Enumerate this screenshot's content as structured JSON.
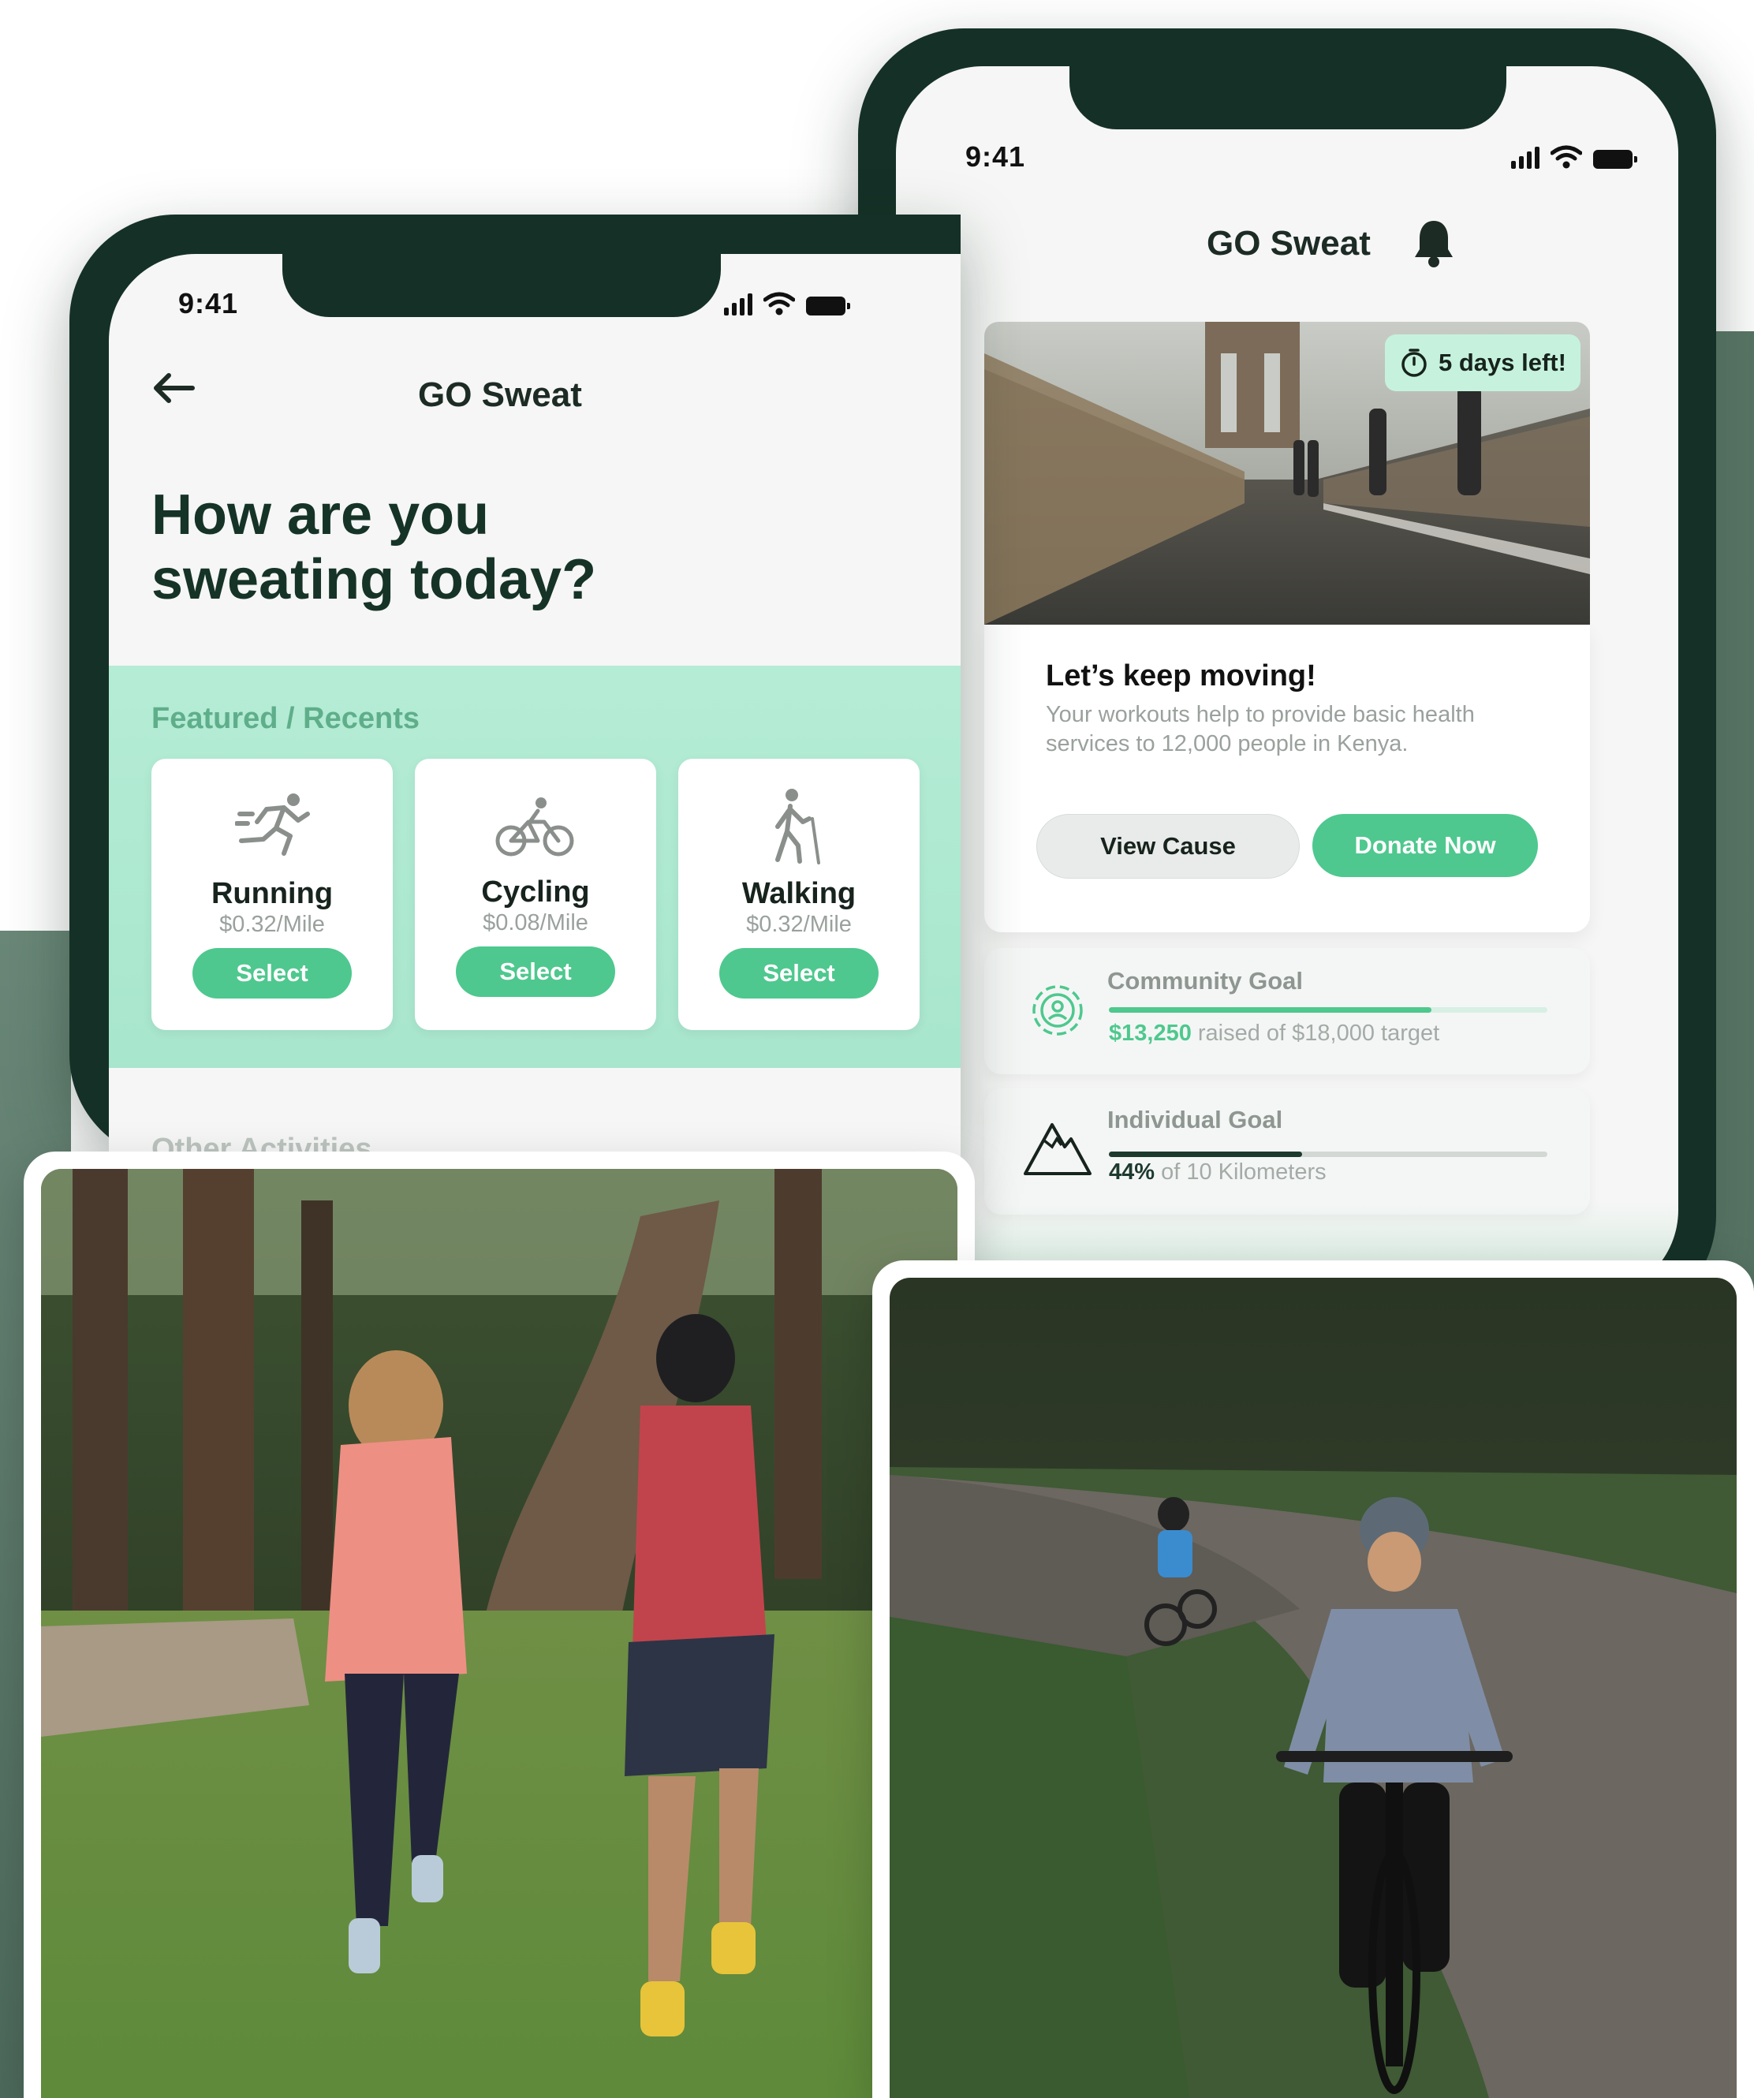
{
  "left_phone": {
    "status_time": "9:41",
    "app_title": "GO Sweat",
    "headline_line1": "How are you",
    "headline_line2": "sweating today?",
    "featured_label": "Featured / Recents",
    "activities": [
      {
        "name": "Running",
        "rate": "$0.32/Mile",
        "button": "Select",
        "icon": "running-icon"
      },
      {
        "name": "Cycling",
        "rate": "$0.08/Mile",
        "button": "Select",
        "icon": "cycling-icon"
      },
      {
        "name": "Walking",
        "rate": "$0.32/Mile",
        "button": "Select",
        "icon": "walking-icon"
      }
    ],
    "other_label": "Other Activities"
  },
  "right_phone": {
    "status_time": "9:41",
    "app_title": "GO Sweat",
    "timer_badge": "5 days left!",
    "cause_title": "Let’s keep moving!",
    "cause_text_line1": "Your workouts help to provide basic health",
    "cause_text_line2": "services to 12,000 people in Kenya.",
    "view_cause_button": "View Cause",
    "donate_button": "Donate Now",
    "community_goal": {
      "title": "Community Goal",
      "raised": "$13,250",
      "rest": "raised of $18,000 target",
      "progress": 0.736
    },
    "individual_goal": {
      "title": "Individual Goal",
      "percent": "44%",
      "rest": "of 10 Kilometers",
      "progress": 0.44
    }
  },
  "colors": {
    "dark_green": "#153127",
    "accent_green": "#4ec88e",
    "mint": "#b5ecd6"
  }
}
